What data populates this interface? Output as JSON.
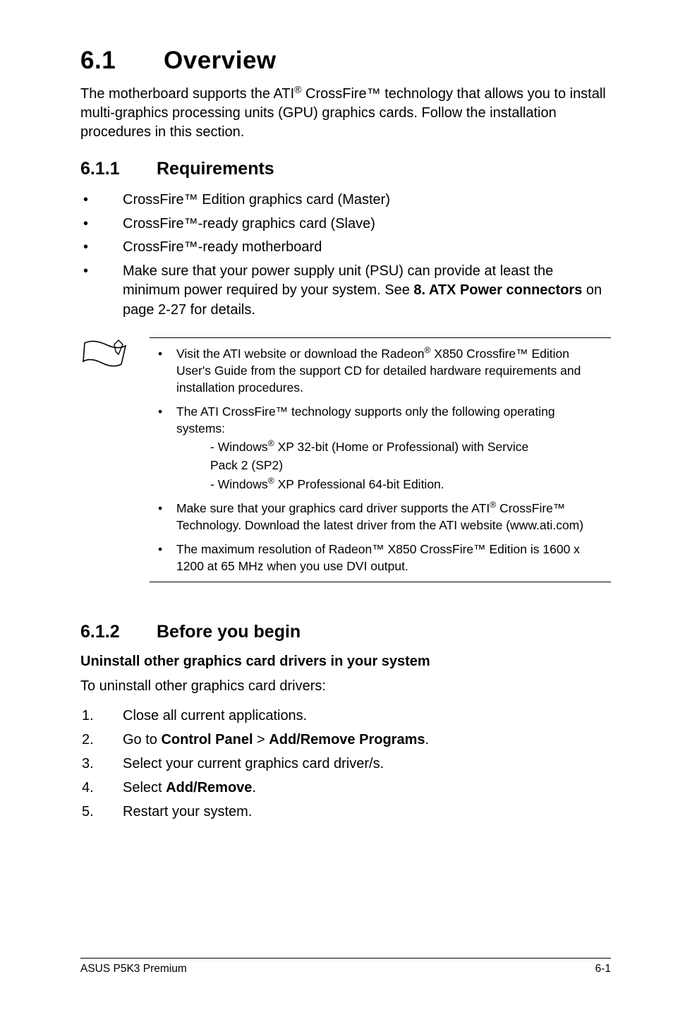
{
  "header": {
    "number": "6.1",
    "title": "Overview"
  },
  "intro": {
    "pre": "The motherboard supports the ATI",
    "sup1": "®",
    "post": " CrossFire™ technology that allows you to install multi-graphics processing units (GPU) graphics cards. Follow the installation procedures in this section."
  },
  "section611": {
    "number": "6.1.1",
    "title": "Requirements",
    "bullets": [
      "CrossFire™ Edition graphics card (Master)",
      "CrossFire™-ready graphics card (Slave)",
      "CrossFire™-ready motherboard"
    ],
    "bullet4": {
      "pre": "Make sure that your power supply unit (PSU) can provide at least the minimum power required by your system. See ",
      "bold": "8. ATX Power connectors",
      "post": " on page 2-27 for details."
    }
  },
  "note": {
    "item1": {
      "pre": "Visit the ATI website or download the Radeon",
      "sup": "®",
      "post": " X850 Crossfire™ Edition User's Guide from the support CD for detailed hardware requirements and installation procedures."
    },
    "item2": {
      "line1": "The ATI CrossFire™ technology supports only the following operating systems:",
      "sub1a": "- Windows",
      "sub1sup": "®",
      "sub1b": " XP 32-bit  (Home or Professional) with Service",
      "sub1c": "  Pack 2 (SP2)",
      "sub2a": "- Windows",
      "sub2sup": "®",
      "sub2b": " XP Professional 64-bit Edition."
    },
    "item3": {
      "pre": "Make sure that your graphics card driver supports the ATI",
      "sup": "®",
      "post": " CrossFire™ Technology. Download the latest driver from the ATI website (www.ati.com)"
    },
    "item4": "The maximum resolution of Radeon™ X850 CrossFire™ Edition is 1600 x 1200 at 65 MHz when you use DVI output."
  },
  "section612": {
    "number": "6.1.2",
    "title": "Before you begin",
    "subheading": "Uninstall other graphics card drivers in your system",
    "lead": "To uninstall other graphics card drivers:",
    "steps": {
      "s1": "Close all current applications.",
      "s2a": "Go to ",
      "s2b": "Control Panel",
      "s2c": " > ",
      "s2d": "Add/Remove Programs",
      "s2e": ".",
      "s3": "Select your current graphics card driver/s.",
      "s4a": "Select ",
      "s4b": "Add/Remove",
      "s4c": ".",
      "s5": "Restart your system."
    }
  },
  "footer": {
    "left": "ASUS P5K3 Premium",
    "right": "6-1"
  },
  "icons": {
    "note": "note-icon"
  }
}
